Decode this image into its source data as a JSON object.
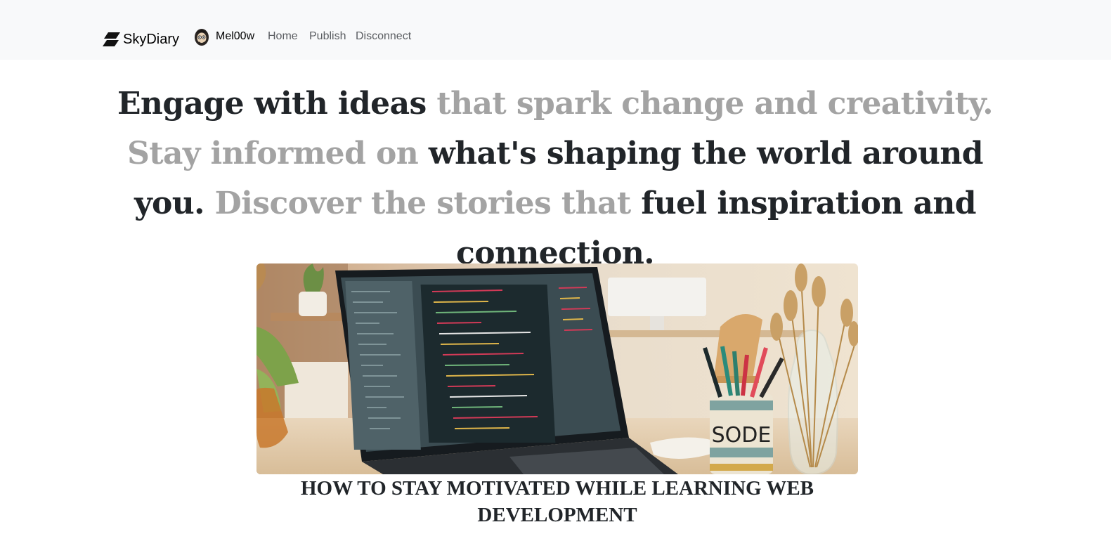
{
  "navbar": {
    "brand": "SkyDiary",
    "user": {
      "name": "Mel00w",
      "avatar_icon": "avatar-icon"
    },
    "links": {
      "home": "Home",
      "publish": "Publish",
      "disconnect": "Disconnect"
    }
  },
  "hero": {
    "segments": [
      {
        "text": "Engage with ideas ",
        "tone": "dark"
      },
      {
        "text": "that spark change and creativity. Stay informed on ",
        "tone": "muted"
      },
      {
        "text": "what's shaping the world around you. ",
        "tone": "dark"
      },
      {
        "text": "Discover the stories that ",
        "tone": "muted"
      },
      {
        "text": "fuel inspiration and connection.",
        "tone": "dark"
      }
    ]
  },
  "post": {
    "title": "HOW TO STAY MOTIVATED WHILE LEARNING WEB DEVELOPMENT",
    "mug_text": "SODE"
  },
  "colors": {
    "navbar_bg": "#f8f9fa",
    "text_dark": "#212529",
    "text_muted": "#a3a3a3",
    "link": "#5a5d61"
  }
}
